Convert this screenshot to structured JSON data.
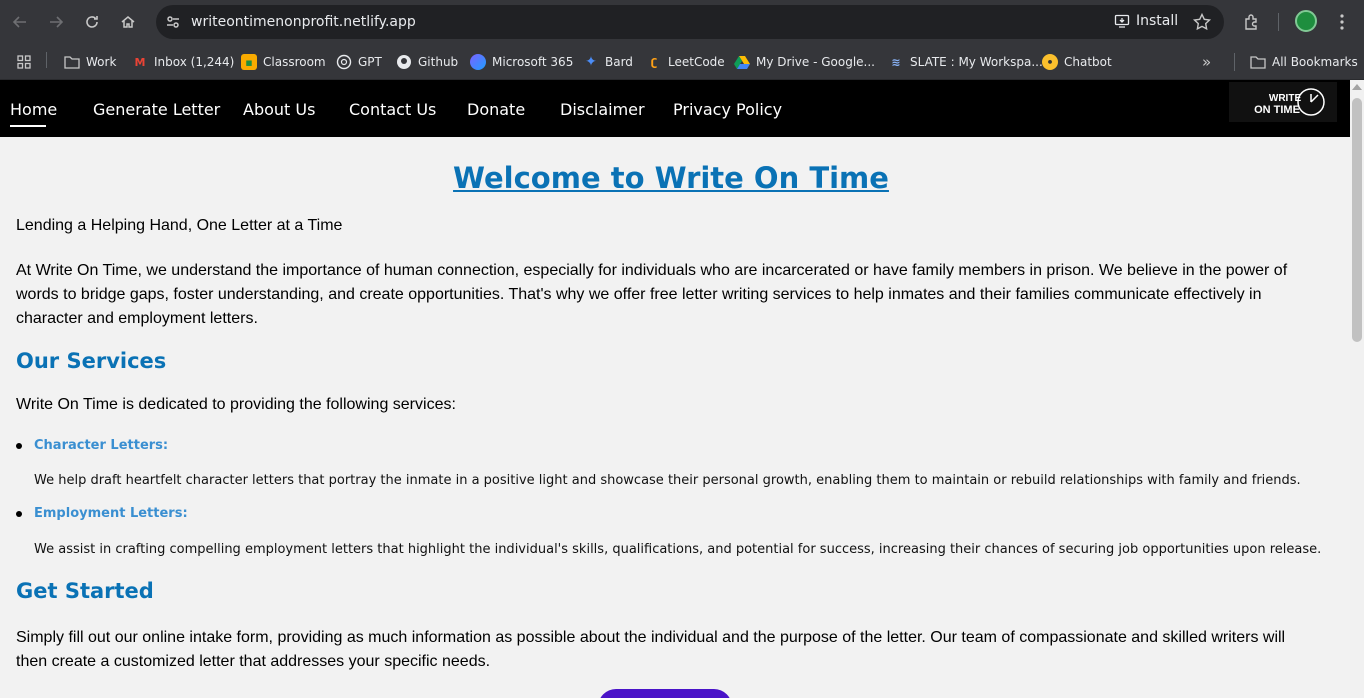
{
  "browser": {
    "url": "writeontimenonprofit.netlify.app",
    "install_label": "Install",
    "bookmarks": [
      {
        "label": "Work",
        "icon": "folder-icon"
      },
      {
        "label": "Inbox (1,244)",
        "icon": "gmail-icon"
      },
      {
        "label": "Classroom",
        "icon": "classroom-icon"
      },
      {
        "label": "GPT",
        "icon": "gpt-icon"
      },
      {
        "label": "Github",
        "icon": "github-icon"
      },
      {
        "label": "Microsoft 365",
        "icon": "microsoft-365-icon"
      },
      {
        "label": "Bard",
        "icon": "bard-icon"
      },
      {
        "label": "LeetCode",
        "icon": "leetcode-icon"
      },
      {
        "label": "My Drive - Google...",
        "icon": "drive-icon"
      },
      {
        "label": "SLATE : My Workspa...",
        "icon": "slate-icon"
      },
      {
        "label": "Chatbot",
        "icon": "chatbot-icon"
      }
    ],
    "all_bookmarks_label": "All Bookmarks"
  },
  "site": {
    "nav": [
      "Home",
      "Generate Letter",
      "About Us",
      "Contact Us",
      "Donate",
      "Disclaimer",
      "Privacy Policy"
    ],
    "logo_text_top": "WRITE",
    "logo_text_bottom": "ON TIME"
  },
  "main": {
    "title": "Welcome to Write On Time",
    "tagline": "Lending a Helping Hand, One Letter at a Time",
    "intro": "At Write On Time, we understand the importance of human connection, especially for individuals who are incarcerated or have family members in prison. We believe in the power of words to bridge gaps, foster understanding, and create opportunities. That's why we offer free letter writing services to help inmates and their families communicate effectively in character and employment letters.",
    "services_heading": "Our Services",
    "services_intro": "Write On Time is dedicated to providing the following services:",
    "services": [
      {
        "title": "Character Letters:",
        "desc": "We help draft heartfelt character letters that portray the inmate in a positive light and showcase their personal growth, enabling them to maintain or rebuild relationships with family and friends."
      },
      {
        "title": "Employment Letters:",
        "desc": "We assist in crafting compelling employment letters that highlight the individual's skills, qualifications, and potential for success, increasing their chances of securing job opportunities upon release."
      }
    ],
    "started_heading": "Get Started",
    "started_text": "Simply fill out our online intake form, providing as much information as possible about the individual and the purpose of the letter. Our team of compassionate and skilled writers will then create a customized letter that addresses your specific needs."
  },
  "colors": {
    "heading_blue": "#0a72b5",
    "service_blue": "#3a8fd1",
    "cta_purple": "#4a14c8",
    "nav_bg": "#000000"
  }
}
